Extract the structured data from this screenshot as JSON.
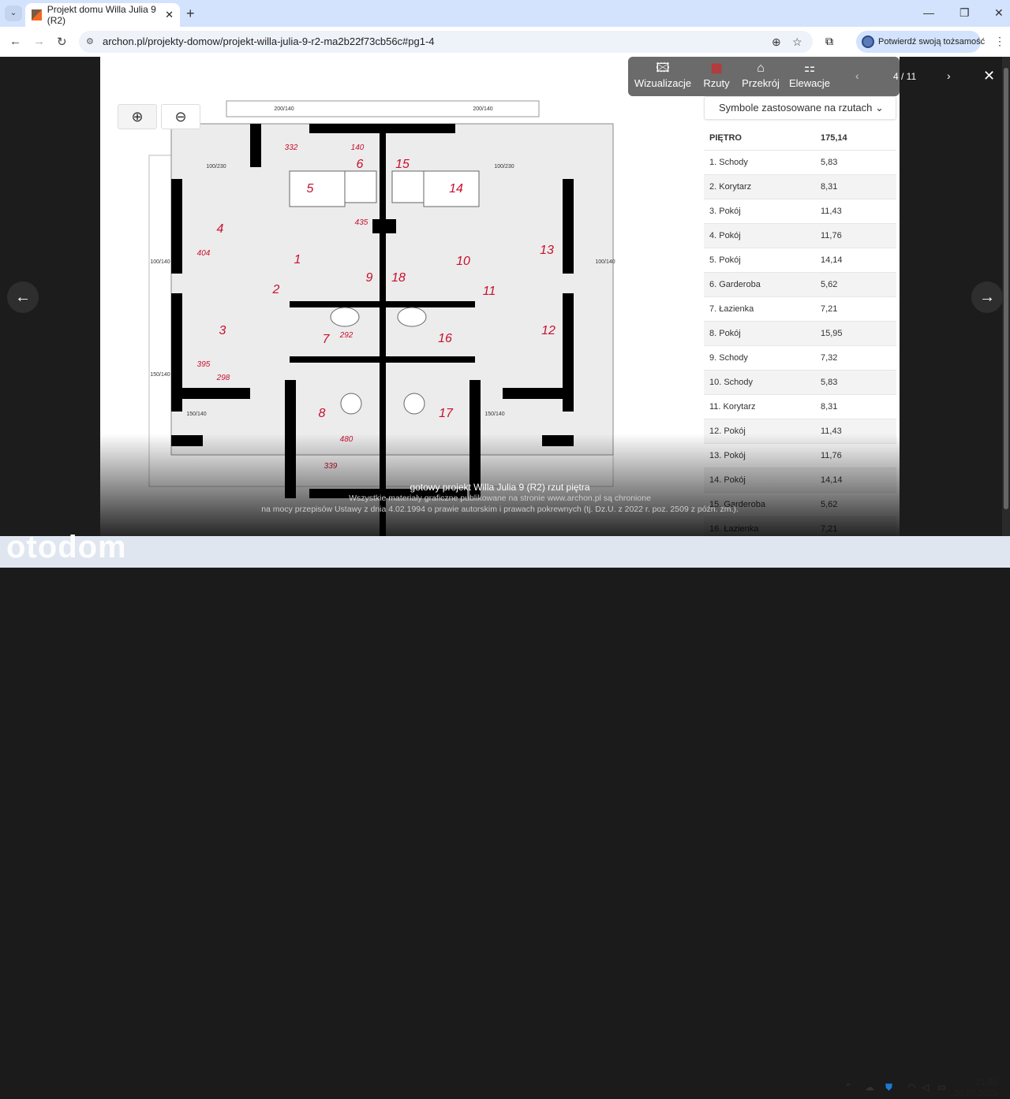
{
  "browser": {
    "tab_title": "Projekt domu Willa Julia 9 (R2)",
    "url": "archon.pl/projekty-domow/projekt-willa-julia-9-r2-ma2b22f73cb56c#pg1-4",
    "verify_label": "Potwierdź swoją tożsamość"
  },
  "viewer": {
    "toolbar": [
      {
        "label": "Wizualizacje",
        "icon": "image-icon"
      },
      {
        "label": "Rzuty",
        "icon": "floorplan-icon",
        "active": true
      },
      {
        "label": "Przekrój",
        "icon": "house-section-icon"
      },
      {
        "label": "Elewacje",
        "icon": "elevations-icon"
      }
    ],
    "pager": "4 / 11",
    "symbols_dropdown": "Symbole zastosowane na rzutach",
    "caption": "gotowy projekt Willa Julia 9 (R2) rzut piętra",
    "copyright_1": "Wszystkie materiały graficzne publikowane na stronie www.archon.pl są chronione",
    "copyright_2": "na mocy przepisów Ustawy z dnia 4.02.1994 o prawie autorskim i prawach pokrewnych (tj. Dz.U. z 2022 r. poz. 2509 z późn. zm.).",
    "table_header": {
      "name": "PIĘTRO",
      "area": "175,14"
    },
    "rooms": [
      {
        "name": "1. Schody",
        "area": "5,83"
      },
      {
        "name": "2. Korytarz",
        "area": "8,31"
      },
      {
        "name": "3. Pokój",
        "area": "11,43"
      },
      {
        "name": "4. Pokój",
        "area": "11,76"
      },
      {
        "name": "5. Pokój",
        "area": "14,14"
      },
      {
        "name": "6. Garderoba",
        "area": "5,62"
      },
      {
        "name": "7. Łazienka",
        "area": "7,21"
      },
      {
        "name": "8. Pokój",
        "area": "15,95"
      },
      {
        "name": "9. Schody",
        "area": "7,32"
      },
      {
        "name": "10. Schody",
        "area": "5,83"
      },
      {
        "name": "11. Korytarz",
        "area": "8,31"
      },
      {
        "name": "12. Pokój",
        "area": "11,43"
      },
      {
        "name": "13. Pokój",
        "area": "11,76"
      },
      {
        "name": "14. Pokój",
        "area": "14,14"
      },
      {
        "name": "15. Garderoba",
        "area": "5,62"
      },
      {
        "name": "16. Łazienka",
        "area": "7,21"
      }
    ],
    "plan_labels": {
      "rooms": [
        "1",
        "2",
        "3",
        "4",
        "5",
        "6",
        "7",
        "8",
        "9",
        "10",
        "11",
        "12",
        "13",
        "14",
        "15",
        "16",
        "17",
        "18"
      ],
      "dims": [
        "332",
        "140",
        "404",
        "435",
        "395",
        "298",
        "480",
        "339",
        "292"
      ],
      "windows": [
        "200/140",
        "100/230",
        "100/140",
        "150/140"
      ]
    }
  },
  "taskbar": {
    "time": "21:50",
    "date": "20.07.2025",
    "watermark": "otodom"
  }
}
